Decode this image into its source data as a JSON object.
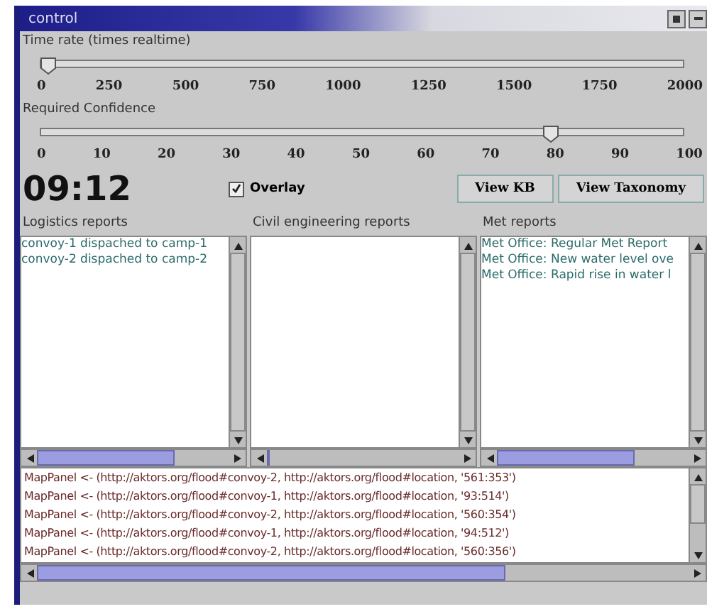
{
  "window": {
    "title": "control"
  },
  "sliders": [
    {
      "label": "Time rate (times realtime)",
      "level": 0.0,
      "ticks": [
        "0",
        "250",
        "500",
        "750",
        "1000",
        "1250",
        "1500",
        "1750",
        "2000"
      ]
    },
    {
      "label": "Required Confidence",
      "level": 0.8,
      "ticks": [
        "0",
        "10",
        "20",
        "30",
        "40",
        "50",
        "60",
        "70",
        "80",
        "90",
        "100"
      ]
    }
  ],
  "clock": "09:12",
  "overlay": {
    "label": "Overlay",
    "checked": true
  },
  "buttons": [
    "View KB",
    "View Taxonomy"
  ],
  "panels": [
    {
      "title": "Logistics reports",
      "lines": [
        "convoy-1 dispached to camp-1",
        "convoy-2 dispached to camp-2"
      ]
    },
    {
      "title": "Civil engineering reports"
    },
    {
      "title": "Met reports",
      "lines": [
        "Met Office: Regular Met Report",
        "Met Office: New water level ove",
        "Met Office: Rapid rise in water l"
      ]
    }
  ],
  "log": [
    "MapPanel <- (http://aktors.org/flood#convoy-2, http://aktors.org/flood#location, '561:353')",
    "MapPanel <- (http://aktors.org/flood#convoy-1, http://aktors.org/flood#location, '93:514')",
    "MapPanel <- (http://aktors.org/flood#convoy-2, http://aktors.org/flood#location, '560:354')",
    "MapPanel <- (http://aktors.org/flood#convoy-1, http://aktors.org/flood#location, '94:512')",
    "MapPanel <- (http://aktors.org/flood#convoy-2, http://aktors.org/flood#location, '560:356')"
  ]
}
